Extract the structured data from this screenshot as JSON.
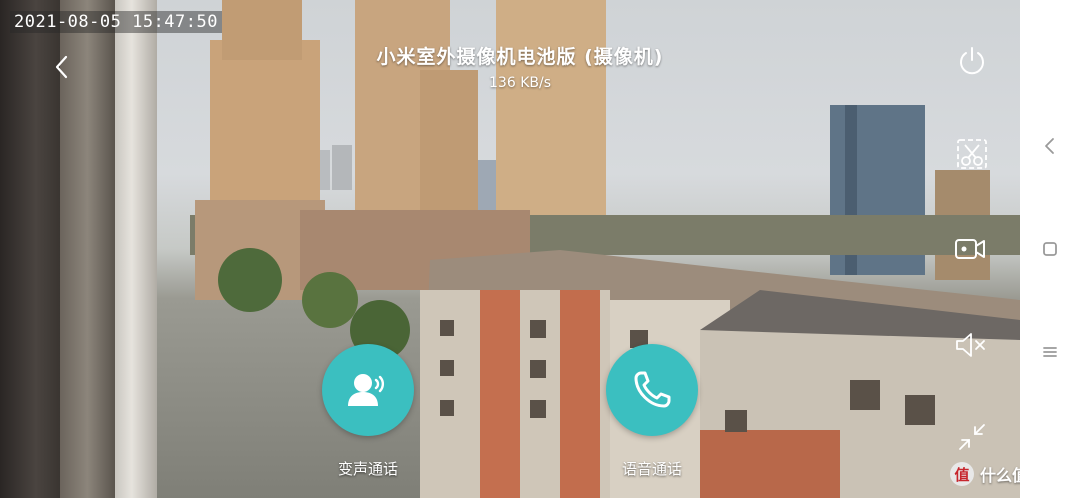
{
  "feed": {
    "timestamp": "2021-08-05 15:47:50"
  },
  "header": {
    "title": "小米室外摄像机电池版 (摄像机)",
    "speed": "136 KB/s"
  },
  "icons": {
    "back": "chevron-left-icon",
    "power": "power-icon",
    "screenshot": "scissors-icon",
    "record": "video-record-icon",
    "mute": "speaker-mute-icon",
    "fullscreen": "collapse-arrows-icon"
  },
  "actions": {
    "voice_change_label": "变声通话",
    "voice_call_label": "语音通话"
  },
  "colors": {
    "accent": "#3bbfc0"
  },
  "watermark": {
    "logo_char": "值",
    "text": "什么值得买"
  }
}
